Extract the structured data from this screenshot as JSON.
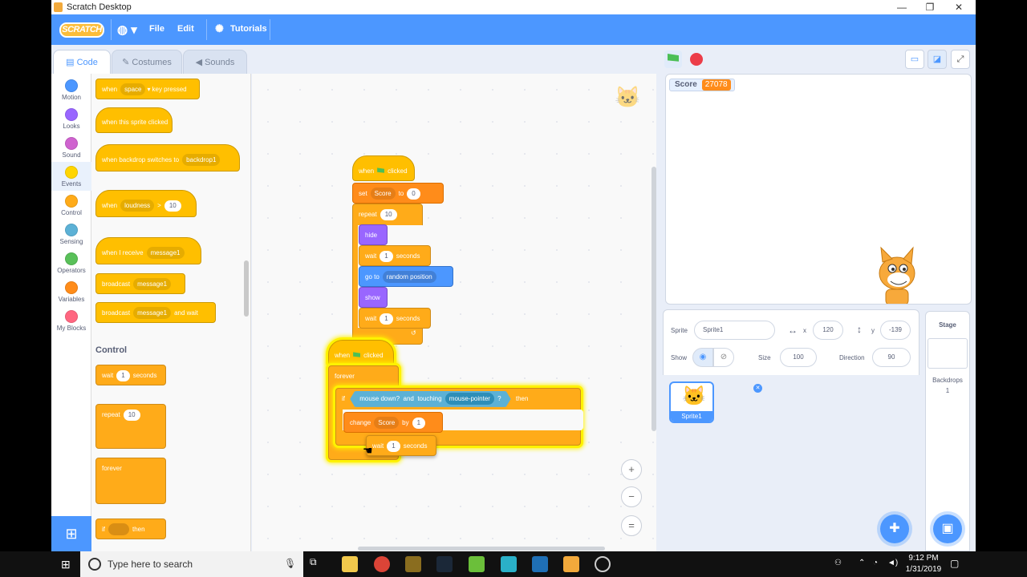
{
  "window": {
    "title": "Scratch Desktop",
    "controls": {
      "minimize": "—",
      "maximize": "❐",
      "close": "✕"
    }
  },
  "menubar": {
    "logo": "SCRATCH",
    "language_icon": "globe-icon",
    "items": [
      "File",
      "Edit"
    ],
    "tutorials": "Tutorials"
  },
  "tabs": [
    "Code",
    "Costumes",
    "Sounds"
  ],
  "categories": [
    {
      "label": "Motion",
      "color": "#4c97ff"
    },
    {
      "label": "Looks",
      "color": "#9966ff"
    },
    {
      "label": "Sound",
      "color": "#cf63cf"
    },
    {
      "label": "Events",
      "color": "#ffd500"
    },
    {
      "label": "Control",
      "color": "#ffab19"
    },
    {
      "label": "Sensing",
      "color": "#5cb1d6"
    },
    {
      "label": "Operators",
      "color": "#59c059"
    },
    {
      "label": "Variables",
      "color": "#ff8c1a"
    },
    {
      "label": "My Blocks",
      "color": "#ff6680"
    }
  ],
  "palette": {
    "events": {
      "key_pressed": {
        "a": "when",
        "key": "space",
        "b": "key pressed"
      },
      "sprite_clicked": "when this sprite clicked",
      "backdrop_switch": {
        "a": "when backdrop switches to",
        "value": "backdrop1"
      },
      "loudness": {
        "a": "when",
        "sensor": "loudness",
        "op": ">",
        "value": "10"
      },
      "receive": {
        "a": "when I receive",
        "message": "message1"
      },
      "broadcast": {
        "a": "broadcast",
        "message": "message1"
      },
      "broadcast_wait": {
        "a": "broadcast",
        "message": "message1",
        "b": "and wait"
      }
    },
    "control_label": "Control",
    "control": {
      "wait": {
        "a": "wait",
        "value": "1",
        "b": "seconds"
      },
      "repeat": {
        "a": "repeat",
        "value": "10"
      },
      "forever": "forever",
      "if": {
        "a": "if",
        "b": "then"
      }
    }
  },
  "script1": {
    "hat": {
      "a": "when",
      "b": "clicked"
    },
    "set": {
      "a": "set",
      "var": "Score",
      "b": "to",
      "value": "0"
    },
    "repeat": {
      "a": "repeat",
      "value": "10"
    },
    "hide": "hide",
    "wait1": {
      "a": "wait",
      "value": "1",
      "b": "seconds"
    },
    "goto": {
      "a": "go to",
      "target": "random position"
    },
    "show": "show",
    "wait2": {
      "a": "wait",
      "value": "1",
      "b": "seconds"
    }
  },
  "script2": {
    "hat": {
      "a": "when",
      "b": "clicked"
    },
    "forever": "forever",
    "if": {
      "a": "if",
      "cond1": "mouse down?",
      "and": "and",
      "touching": "touching",
      "target": "mouse-pointer",
      "q": "?",
      "b": "then"
    },
    "change": {
      "a": "change",
      "var": "Score",
      "b": "by",
      "value": "1"
    },
    "wait": {
      "a": "wait",
      "value": "1",
      "b": "seconds"
    }
  },
  "zoom": {
    "in": "+",
    "out": "−",
    "reset": "="
  },
  "stage": {
    "monitor_label": "Score",
    "monitor_value": "27078"
  },
  "sprite_info": {
    "sprite_label": "Sprite",
    "sprite_name": "Sprite1",
    "x_label": "x",
    "x": "120",
    "y_label": "y",
    "y": "-139",
    "show_label": "Show",
    "size_label": "Size",
    "size": "100",
    "direction_label": "Direction",
    "direction": "90"
  },
  "sprites": [
    {
      "name": "Sprite1"
    }
  ],
  "stage_pane": {
    "label": "Stage",
    "backdrops_label": "Backdrops",
    "backdrops_count": "1"
  },
  "taskbar": {
    "search_placeholder": "Type here to search",
    "time": "9:12 PM",
    "date": "1/31/2019"
  }
}
